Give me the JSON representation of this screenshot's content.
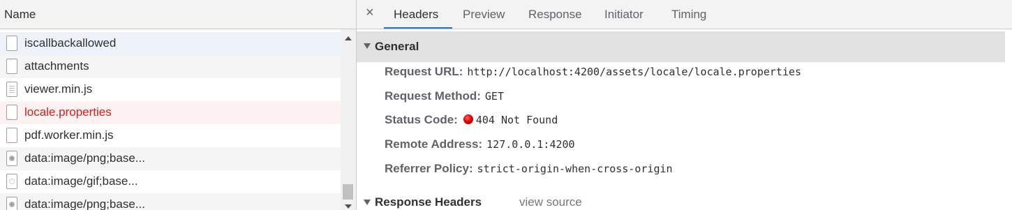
{
  "list": {
    "header": "Name",
    "rows": [
      {
        "label": "iscallbackallowed",
        "icon": "document-icon"
      },
      {
        "label": "attachments",
        "icon": "document-icon"
      },
      {
        "label": "viewer.min.js",
        "icon": "script-file-icon"
      },
      {
        "label": "locale.properties",
        "icon": "document-icon",
        "status": "error"
      },
      {
        "label": "pdf.worker.min.js",
        "icon": "document-icon"
      },
      {
        "label": "data:image/png;base...",
        "icon": "image-file-icon"
      },
      {
        "label": "data:image/gif;base...",
        "icon": "gif-file-icon"
      },
      {
        "label": "data:image/png;base...",
        "icon": "image-file-icon"
      }
    ]
  },
  "tabs": {
    "close": "×",
    "items": [
      "Headers",
      "Preview",
      "Response",
      "Initiator",
      "Timing"
    ],
    "active": "Headers"
  },
  "general": {
    "title": "General",
    "request_url_label": "Request URL:",
    "request_url": "http://localhost:4200/assets/locale/locale.properties",
    "request_method_label": "Request Method:",
    "request_method": "GET",
    "status_code_label": "Status Code:",
    "status_code": "404 Not Found",
    "remote_address_label": "Remote Address:",
    "remote_address": "127.0.0.1:4200",
    "referrer_policy_label": "Referrer Policy:",
    "referrer_policy": "strict-origin-when-cross-origin"
  },
  "response_headers": {
    "title": "Response Headers",
    "view_source": "view source"
  },
  "colors": {
    "accent": "#1a73e8",
    "error_text": "#d21e1e",
    "status_dot": "#e10000"
  }
}
